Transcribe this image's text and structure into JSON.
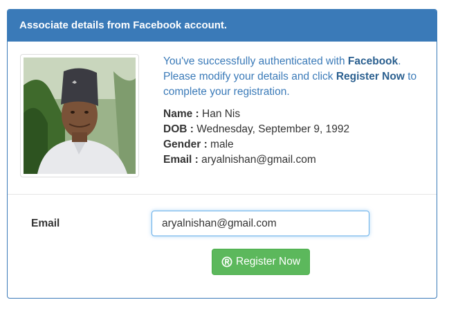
{
  "panel": {
    "title": "Associate details from Facebook account."
  },
  "intro": {
    "text_1": "You've successfully authenticated with ",
    "provider": "Facebook",
    "text_2": ".",
    "text_3": "Please modify your details and click ",
    "action": "Register Now",
    "text_4": " to complete your registration."
  },
  "details": {
    "name_label": "Name :",
    "name_value": "Han Nis",
    "dob_label": "DOB :",
    "dob_value": "Wednesday, September 9, 1992",
    "gender_label": "Gender :",
    "gender_value": "male",
    "email_label": "Email :",
    "email_value": "aryalnishan@gmail.com"
  },
  "form": {
    "email_label": "Email",
    "email_value": "aryalnishan@gmail.com",
    "register_label": "Register Now",
    "register_icon": "registered-icon"
  },
  "colors": {
    "primary": "#3a7ab8",
    "success": "#5cb85c"
  }
}
